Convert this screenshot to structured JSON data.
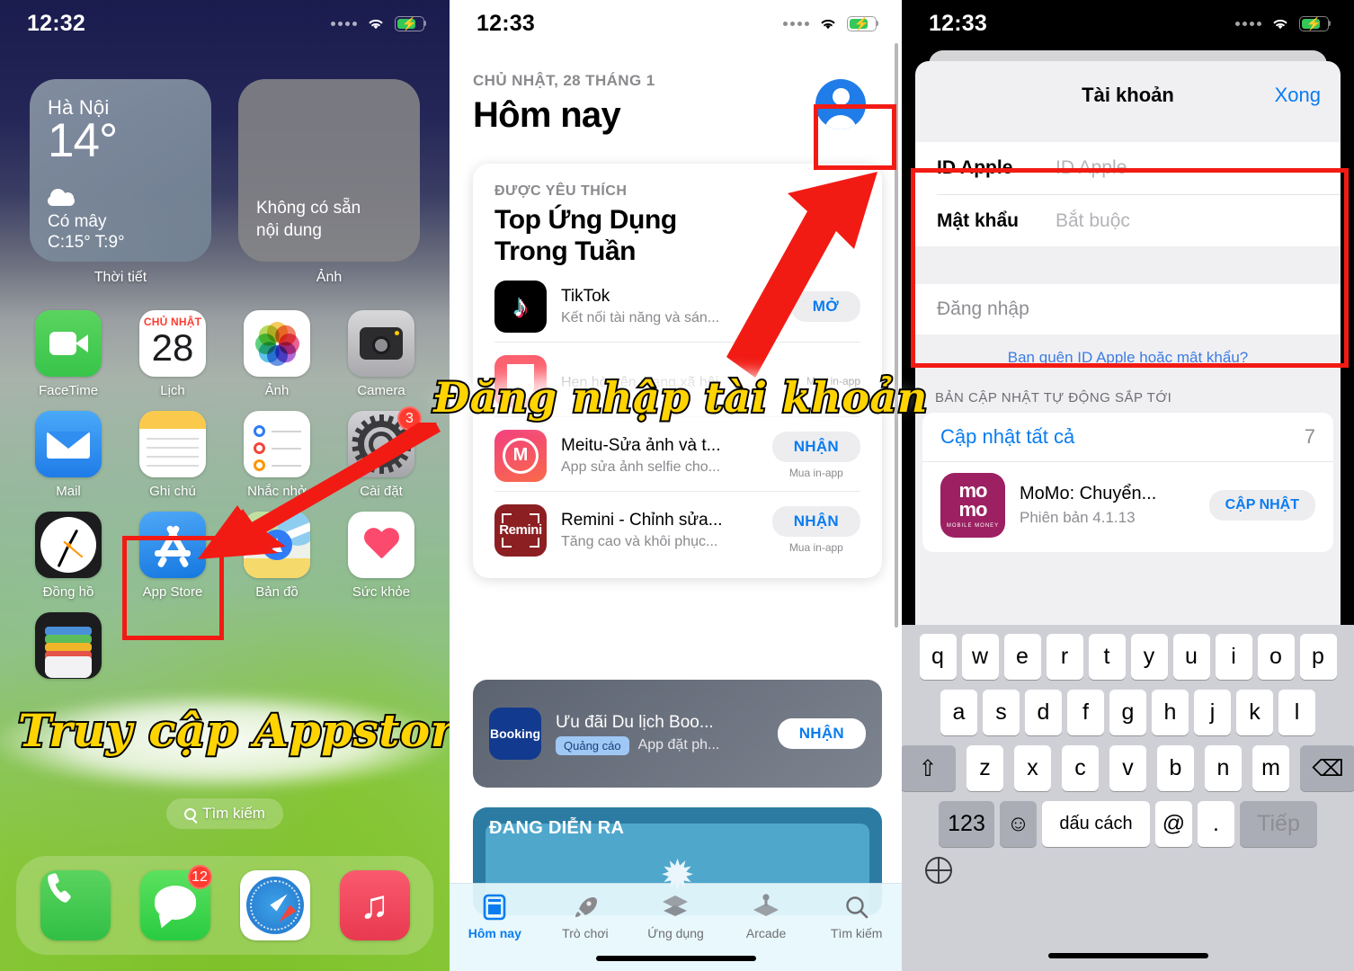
{
  "panel_home": {
    "status": {
      "time": "12:32",
      "wifi": "wifi-icon",
      "battery": "battery-charging-icon"
    },
    "widgets": [
      {
        "label": "Thời tiết",
        "city": "Hà Nội",
        "temp": "14°",
        "condition": "Có mây",
        "highlow": "C:15° T:9°"
      },
      {
        "label": "Ảnh",
        "empty_text": "Không có sẵn\nnội dung",
        "empty_line1": "Không có sẵn",
        "empty_line2": "nội dung"
      }
    ],
    "apps": [
      {
        "name": "FaceTime"
      },
      {
        "name": "Lịch",
        "cal_dow": "CHỦ NHẬT",
        "cal_day": "28"
      },
      {
        "name": "Ảnh"
      },
      {
        "name": "Camera"
      },
      {
        "name": "Mail"
      },
      {
        "name": "Ghi chú"
      },
      {
        "name": "Nhắc nhở"
      },
      {
        "name": "Cài đặt",
        "badge": "3"
      },
      {
        "name": "Đồng hồ"
      },
      {
        "name": "App Store"
      },
      {
        "name": "Bản đồ"
      },
      {
        "name": "Sức khỏe"
      },
      {
        "name": "Ví"
      }
    ],
    "search_label": "Tìm kiếm",
    "dock": [
      {
        "name": "Điện thoại"
      },
      {
        "name": "Tin nhắn",
        "badge": "12"
      },
      {
        "name": "Safari"
      },
      {
        "name": "Nhạc"
      }
    ],
    "caption": "Truy cập Appstore"
  },
  "panel_appstore": {
    "status": {
      "time": "12:33"
    },
    "date_label": "CHỦ NHẬT, 28 THÁNG 1",
    "title": "Hôm nay",
    "account_icon": "account-avatar-icon",
    "featured": {
      "kicker": "ĐƯỢC YÊU THÍCH",
      "headline_line1": "Top Ứng Dụng",
      "headline_line2": "Trong Tuần",
      "apps": [
        {
          "name": "TikTok",
          "subtitle": "Kết nối tài năng và sán...",
          "button": "MỞ",
          "iap": ""
        },
        {
          "name": "",
          "subtitle": "Hẹn hò trên mạng xã hội",
          "button": "",
          "iap": "Mua in-app"
        },
        {
          "name": "Meitu-Sửa ảnh và t...",
          "subtitle": "App sửa ảnh selfie cho...",
          "button": "NHẬN",
          "iap": "Mua in-app"
        },
        {
          "name": "Remini - Chỉnh sửa...",
          "subtitle": "Tăng cao và khôi phục...",
          "button": "NHẬN",
          "iap": "Mua in-app"
        }
      ]
    },
    "ad": {
      "icon_text": "Booking",
      "title": "Ưu đãi Du lịch Boo...",
      "tag": "Quảng cáo",
      "subtitle": "App đặt ph...",
      "button": "NHẬN"
    },
    "live": {
      "label": "ĐANG DIỄN RA"
    },
    "tabs": [
      {
        "label": "Hôm nay",
        "icon": "today-icon",
        "active": true
      },
      {
        "label": "Trò chơi",
        "icon": "rocket-icon",
        "active": false
      },
      {
        "label": "Ứng dụng",
        "icon": "layers-icon",
        "active": false
      },
      {
        "label": "Arcade",
        "icon": "joystick-icon",
        "active": false
      },
      {
        "label": "Tìm kiếm",
        "icon": "search-icon",
        "active": false
      }
    ],
    "caption": "Đăng nhập tài khoản"
  },
  "panel_account": {
    "status": {
      "time": "12:33"
    },
    "nav": {
      "title": "Tài khoản",
      "done": "Xong"
    },
    "form": {
      "apple_id_label": "ID Apple",
      "apple_id_placeholder": "ID Apple",
      "password_label": "Mật khẩu",
      "password_placeholder": "Bắt buộc",
      "signin_placeholder": "Đăng nhập"
    },
    "forgot_link": "Bạn quên ID Apple hoặc mật khẩu?",
    "updates": {
      "section_header": "BẢN CẬP NHẬT TỰ ĐỘNG SẮP TỚI",
      "update_all_label": "Cập nhật tất cả",
      "update_all_count": "7",
      "items": [
        {
          "icon_line1": "mo",
          "icon_line2": "mo",
          "icon_sub": "MOBILE MONEY",
          "name": "MoMo: Chuyển...",
          "version": "Phiên bản 4.1.13",
          "button": "CẬP NHẬT"
        }
      ]
    },
    "keyboard": {
      "row1": [
        "q",
        "w",
        "e",
        "r",
        "t",
        "y",
        "u",
        "i",
        "o",
        "p"
      ],
      "row2": [
        "a",
        "s",
        "d",
        "f",
        "g",
        "h",
        "j",
        "k",
        "l"
      ],
      "row3": [
        "z",
        "x",
        "c",
        "v",
        "b",
        "n",
        "m"
      ],
      "shift": "shift-icon",
      "backspace": "backspace-icon",
      "numbers": "123",
      "emoji": "emoji-icon",
      "space": "dấu cách",
      "at": "@",
      "period": ".",
      "next": "Tiếp",
      "globe": "globe-icon"
    }
  },
  "colors": {
    "highlight_red": "#f21b14",
    "caption_yellow": "#ffd400",
    "accent_blue": "#0a7cf0",
    "badge_red": "#ff3b30",
    "battery_green": "#34c759"
  }
}
